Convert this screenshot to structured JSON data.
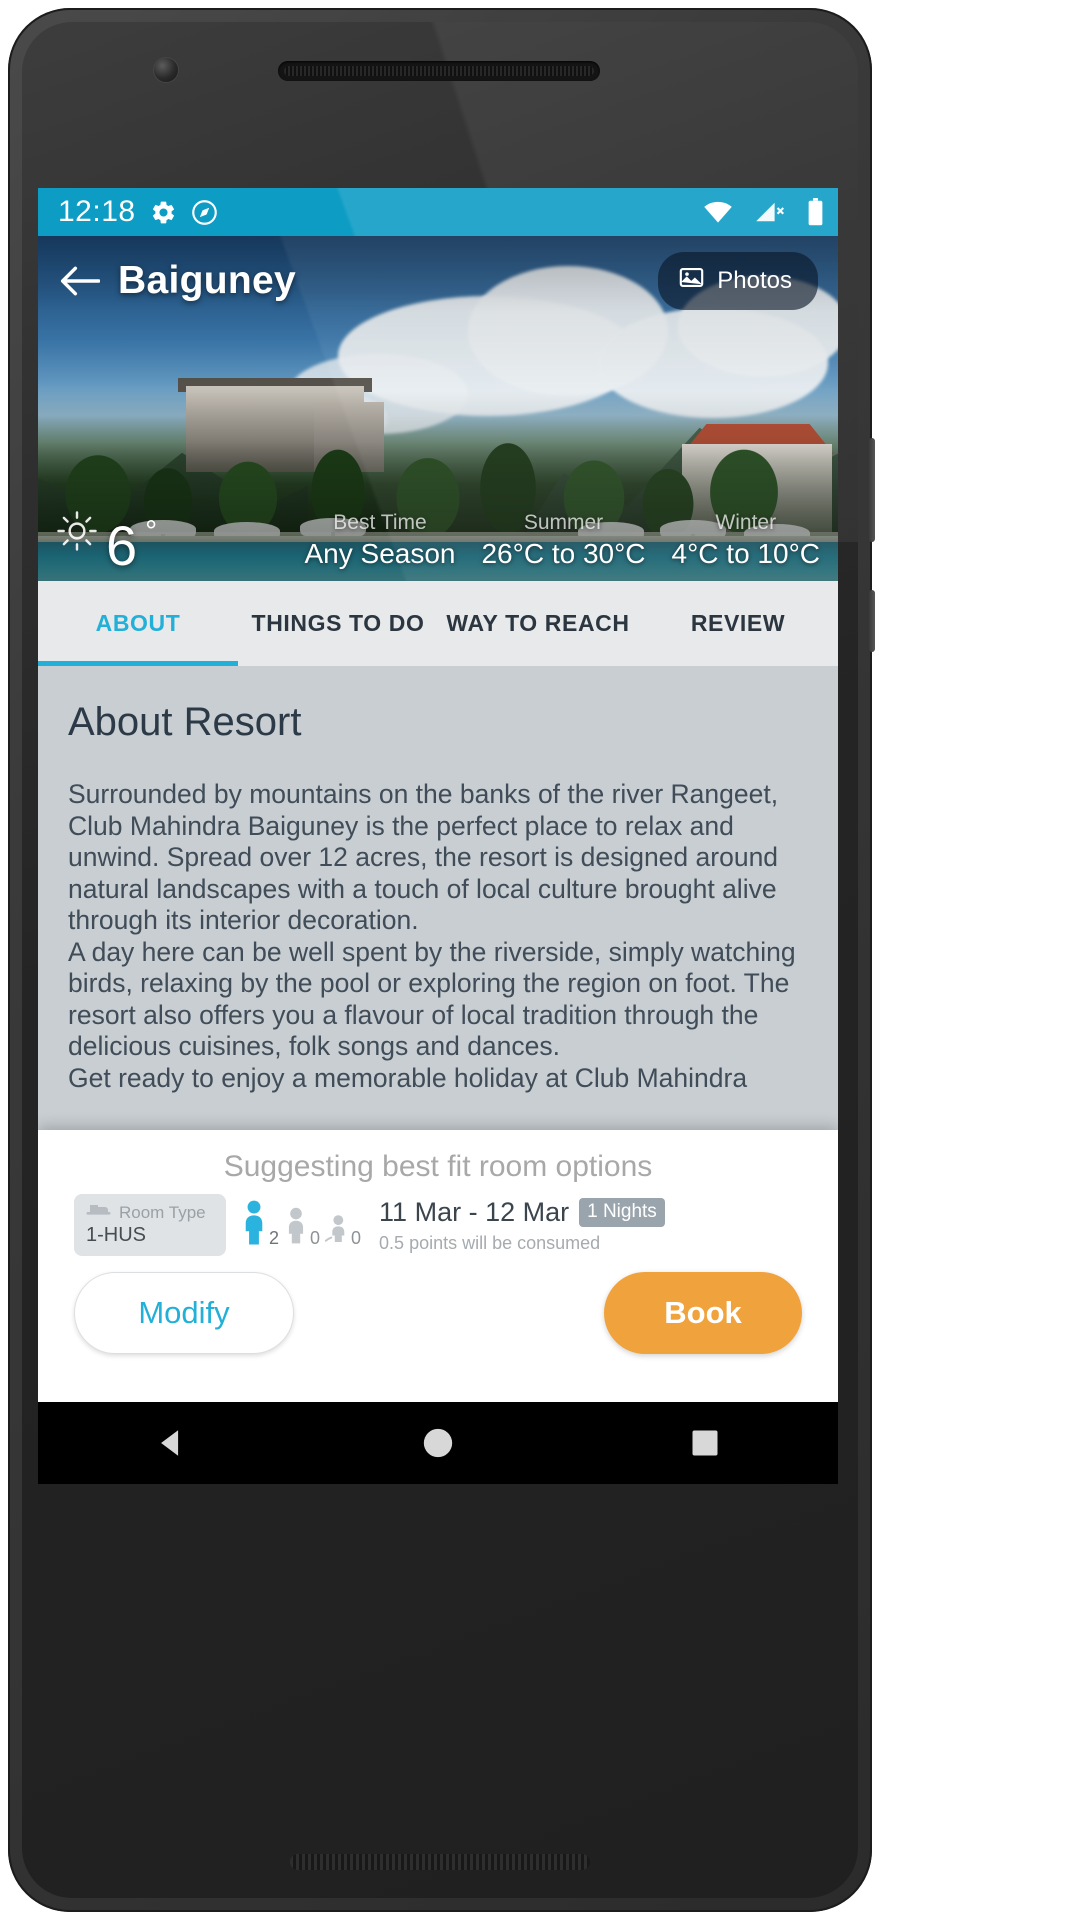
{
  "statusbar": {
    "time": "12:18",
    "icons": [
      "gear-icon",
      "compass-icon",
      "wifi-icon",
      "cellular-off-icon",
      "battery-icon"
    ]
  },
  "header": {
    "back_label": "back-arrow",
    "title": "Baiguney",
    "photos_button": "Photos"
  },
  "weather": {
    "current_temp": "6",
    "degree_symbol": "°",
    "columns": [
      {
        "label": "Best Time",
        "value": "Any Season"
      },
      {
        "label": "Summer",
        "value": "26°C to 30°C"
      },
      {
        "label": "Winter",
        "value": "4°C to 10°C"
      }
    ]
  },
  "tabs": [
    {
      "label": "ABOUT",
      "active": true
    },
    {
      "label": "THINGS TO DO",
      "active": false
    },
    {
      "label": "WAY TO REACH",
      "active": false
    },
    {
      "label": "REVIEW",
      "active": false
    }
  ],
  "about": {
    "title": "About Resort",
    "paragraph1": "Surrounded by mountains on the banks of the river Rangeet, Club Mahindra Baiguney is the perfect place to relax and unwind. Spread over 12 acres, the resort is designed around natural landscapes with a touch of local culture brought alive through its interior decoration.",
    "paragraph2": "A day here can be well spent by the riverside, simply watching birds, relaxing by the pool or exploring the region on foot. The resort also offers you a flavour of local tradition through the delicious cuisines, folk songs and dances.",
    "paragraph3": "Get ready to enjoy a memorable holiday at Club Mahindra"
  },
  "sheet": {
    "title": "Suggesting best fit room options",
    "room": {
      "label": "Room Type",
      "value": "1-HUS"
    },
    "occupancy": [
      {
        "type": "adult",
        "count": "2"
      },
      {
        "type": "child",
        "count": "0"
      },
      {
        "type": "infant",
        "count": "0"
      }
    ],
    "dates": "11 Mar - 12 Mar",
    "nights_badge": "1 Nights",
    "points_note": "0.5 points will be consumed",
    "modify_label": "Modify",
    "book_label": "Book"
  },
  "navbar": {
    "back": "back-triangle-icon",
    "home": "home-circle-icon",
    "recents": "recents-square-icon"
  },
  "colors": {
    "accent": "#23b0d8",
    "statusbar": "#0d9cc4",
    "book_button": "#f0a23c",
    "content_bg": "#c8ced2"
  }
}
